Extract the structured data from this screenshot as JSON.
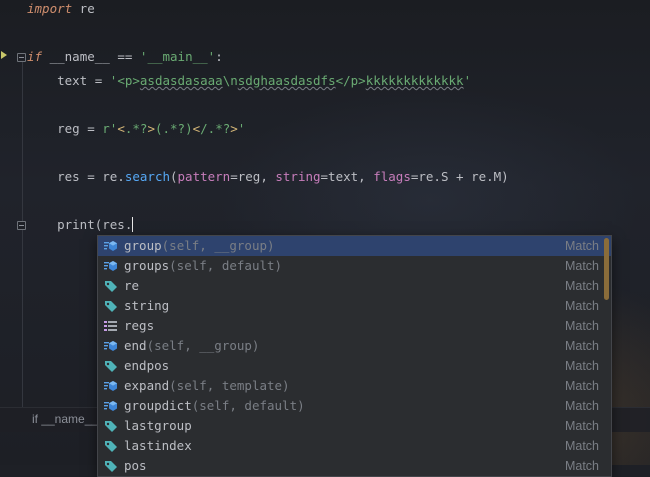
{
  "editor": {
    "lines": [
      {
        "id": "import",
        "tokens": [
          [
            "kw-i",
            "import"
          ],
          [
            "plain",
            " re"
          ]
        ]
      },
      {
        "id": "if-main",
        "tokens": [
          [
            "kw-i",
            "if"
          ],
          [
            "plain",
            " __name__ "
          ],
          [
            "plain",
            "=="
          ],
          [
            "plain",
            " "
          ],
          [
            "str",
            "'__main__'"
          ],
          [
            "plain",
            ":"
          ]
        ]
      },
      {
        "id": "text-assign",
        "tokens": [
          [
            "plain",
            "    text = "
          ],
          [
            "str",
            "'<p>"
          ],
          [
            "str-u",
            "asdasdasaaa"
          ],
          [
            "str",
            "\\n"
          ],
          [
            "str-u",
            "sdghaasdasdfs"
          ],
          [
            "str",
            "</p>"
          ],
          [
            "str-u",
            "kkkkkkkkkkkkk"
          ],
          [
            "str",
            "'"
          ]
        ]
      },
      {
        "id": "reg-assign",
        "tokens": [
          [
            "plain",
            "    reg = "
          ],
          [
            "str",
            "r'"
          ],
          [
            "special",
            "<"
          ],
          [
            "str",
            ".*?"
          ],
          [
            "special",
            ">"
          ],
          [
            "str",
            "(.*?)"
          ],
          [
            "special",
            "<"
          ],
          [
            "str",
            "/.*?"
          ],
          [
            "special",
            ">"
          ],
          [
            "str",
            "'"
          ]
        ]
      },
      {
        "id": "res-assign",
        "tokens": [
          [
            "plain",
            "    res = re."
          ],
          [
            "fn",
            "search"
          ],
          [
            "plain",
            "("
          ],
          [
            "param",
            "pattern"
          ],
          [
            "plain",
            "=reg, "
          ],
          [
            "param",
            "string"
          ],
          [
            "plain",
            "=text, "
          ],
          [
            "param",
            "flags"
          ],
          [
            "plain",
            "=re.S + re.M)"
          ]
        ]
      },
      {
        "id": "print-call",
        "tokens": [
          [
            "plain",
            "    print(res."
          ]
        ]
      }
    ]
  },
  "autocomplete": {
    "items": [
      {
        "name": "group",
        "sig": "(self, __group)",
        "type": "Match",
        "icon": "method-icon",
        "selected": true
      },
      {
        "name": "groups",
        "sig": "(self, default)",
        "type": "Match",
        "icon": "method-icon"
      },
      {
        "name": "re",
        "sig": "",
        "type": "Match",
        "icon": "property-icon"
      },
      {
        "name": "string",
        "sig": "",
        "type": "Match",
        "icon": "property-icon"
      },
      {
        "name": "regs",
        "sig": "",
        "type": "Match",
        "icon": "field-list-icon"
      },
      {
        "name": "end",
        "sig": "(self, __group)",
        "type": "Match",
        "icon": "method-icon"
      },
      {
        "name": "endpos",
        "sig": "",
        "type": "Match",
        "icon": "property-icon"
      },
      {
        "name": "expand",
        "sig": "(self, template)",
        "type": "Match",
        "icon": "method-icon"
      },
      {
        "name": "groupdict",
        "sig": "(self, default)",
        "type": "Match",
        "icon": "method-icon"
      },
      {
        "name": "lastgroup",
        "sig": "",
        "type": "Match",
        "icon": "property-icon"
      },
      {
        "name": "lastindex",
        "sig": "",
        "type": "Match",
        "icon": "property-icon"
      },
      {
        "name": "pos",
        "sig": "",
        "type": "Match",
        "icon": "property-icon"
      }
    ]
  },
  "breadcrumb": {
    "label": "if __name__"
  },
  "colors": {
    "background": "#1e2026",
    "keyword": "#cf8e6d",
    "string": "#6aab73",
    "param": "#c77dbb",
    "function": "#56a8f5",
    "selection": "#2e436e",
    "popup": "#2b2d30"
  }
}
